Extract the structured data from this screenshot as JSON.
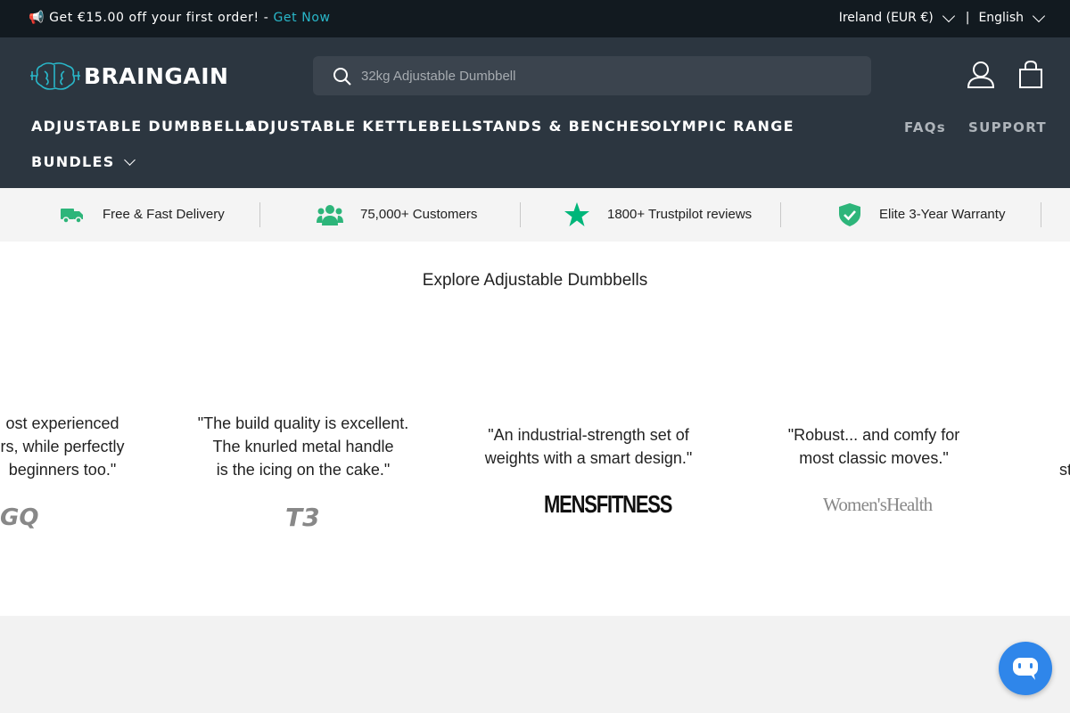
{
  "announcement": {
    "megaphone": "📢",
    "promo_text": "Get €15.00 off your first order! -",
    "promo_link": "Get Now",
    "region": "Ireland (EUR €)",
    "separator": "|",
    "language": "English"
  },
  "header": {
    "logo_text": "BRAINGAIN",
    "search_placeholder": "32kg Adjustable Dumbbell",
    "icons": [
      "search-icon",
      "account-icon",
      "cart-icon"
    ]
  },
  "nav": {
    "items": [
      "ADJUSTABLE DUMBBELLS",
      "ADJUSTABLE KETTLEBELLS",
      "STANDS & BENCHES",
      "OLYMPIC RANGE",
      "BUNDLES"
    ],
    "secondary": [
      "FAQs",
      "SUPPORT"
    ]
  },
  "usp": [
    {
      "icon": "truck-icon",
      "label": "Free & Fast Delivery"
    },
    {
      "icon": "users-icon",
      "label": "75,000+ Customers"
    },
    {
      "icon": "star-icon",
      "label": "1800+ Trustpilot reviews"
    },
    {
      "icon": "shield-check-icon",
      "label": "Elite 3-Year Warranty"
    }
  ],
  "press": {
    "heading": "Explore Adjustable Dumbbells",
    "quotes": [
      {
        "lines": [
          "ost experienced",
          "rs, while perfectly",
          "beginners too.\""
        ],
        "source": "GQ"
      },
      {
        "lines": [
          "\"The build quality is excellent.",
          "The knurled metal handle",
          "is the icing on the cake.\""
        ],
        "source": "T3"
      },
      {
        "lines": [
          "\"An industrial-strength set of",
          "weights with a smart design.\""
        ],
        "source": "MENSFITNESS"
      },
      {
        "lines": [
          "\"Robust... and comfy for",
          "most classic moves.\""
        ],
        "source": "Women'sHealth"
      },
      {
        "lines": [
          "st"
        ],
        "source": ""
      }
    ]
  },
  "colors": {
    "announce_bg": "#121a20",
    "header_bg": "#2c3640",
    "accent": "#29b7c9",
    "usp_green": "#2db57a",
    "trustpilot": "#00b67a",
    "chat_blue": "#2f86ea"
  }
}
